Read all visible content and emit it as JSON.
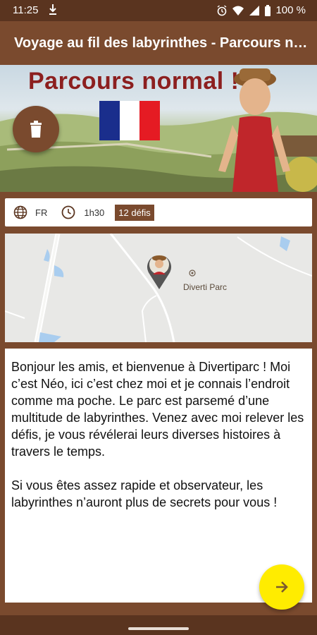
{
  "status_bar": {
    "time": "11:25",
    "battery": "100 %",
    "icons": [
      "download-icon",
      "alarm-icon",
      "wifi-icon",
      "signal-icon",
      "battery-icon"
    ]
  },
  "app_bar": {
    "title": "Voyage au fil des labyrinthes - Parcours normal !"
  },
  "banner": {
    "heading": "Parcours normal !",
    "flag_colors": [
      "#1a2e8c",
      "#ffffff",
      "#e51b23"
    ],
    "delete_icon": "trash-icon"
  },
  "info": {
    "language": "FR",
    "duration": "1h30",
    "challenges": "12 défis",
    "language_icon": "globe-icon",
    "duration_icon": "clock-icon"
  },
  "map": {
    "place_label": "Diverti Parc",
    "marker_icon": "avatar-pin-icon"
  },
  "description": {
    "text": "Bonjour les amis, et bienvenue à Divertiparc ! Moi c’est Néo, ici c’est chez moi et je connais l’endroit comme ma poche. Le parc est parsemé d’une multitude de labyrinthes. Venez avec moi relever les défis, je vous révélerai leurs diverses histoires à travers le temps.\n\nSi vous êtes assez rapide et observateur, les labyrinthes n’auront plus de secrets pour vous !"
  },
  "next_button": {
    "icon": "arrow-right-icon"
  },
  "colors": {
    "primary_brown": "#7a4a2e",
    "dark_brown": "#5a341f",
    "accent_yellow": "#ffec00",
    "heading_red": "#8c1f1f"
  }
}
